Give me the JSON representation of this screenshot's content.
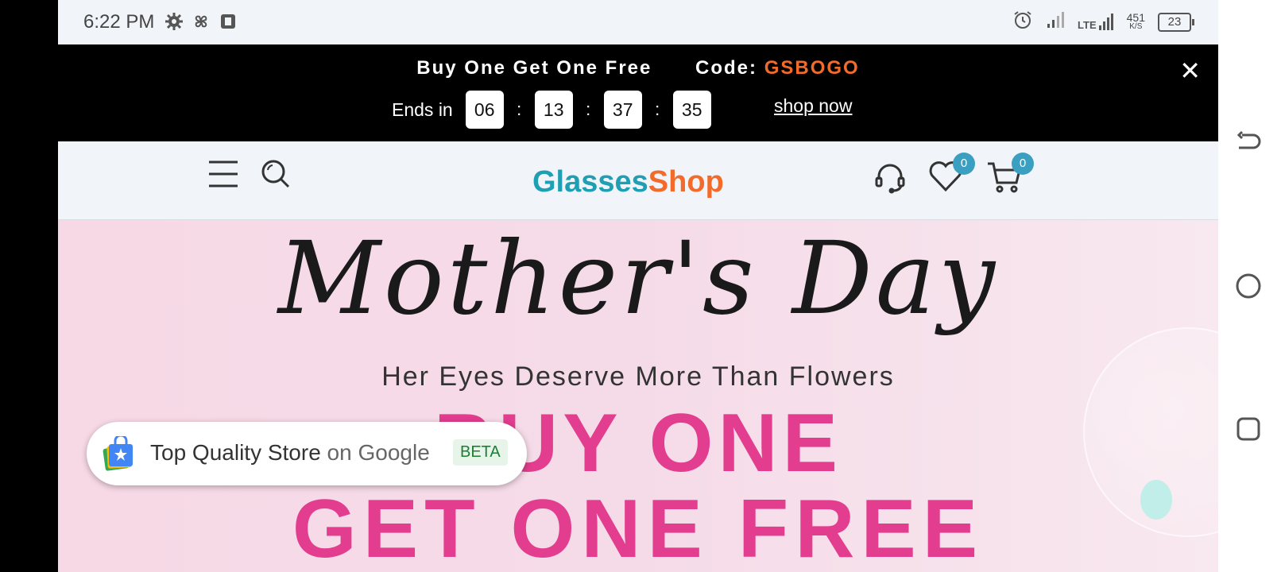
{
  "status_bar": {
    "time": "6:22 PM",
    "network": "LTE",
    "speed_value": "451",
    "speed_unit": "K/S",
    "battery": "23"
  },
  "promo": {
    "title": "Buy One Get One Free",
    "code_label": "Code: ",
    "code_value": "GSBOGO",
    "ends_label": "Ends in",
    "timer": [
      "06",
      "13",
      "37",
      "35"
    ],
    "shop_link": "shop now"
  },
  "header": {
    "logo_first": "Glasses",
    "logo_second": "Shop",
    "wishlist_count": "0",
    "cart_count": "0"
  },
  "hero": {
    "script_title": "Mother's Day",
    "subtitle": "Her Eyes Deserve More Than Flowers",
    "headline_1": "BUY ONE",
    "headline_2": "GET ONE FREE"
  },
  "store_pill": {
    "label": "Top Quality Store",
    "suffix": " on Google",
    "badge": "BETA"
  }
}
